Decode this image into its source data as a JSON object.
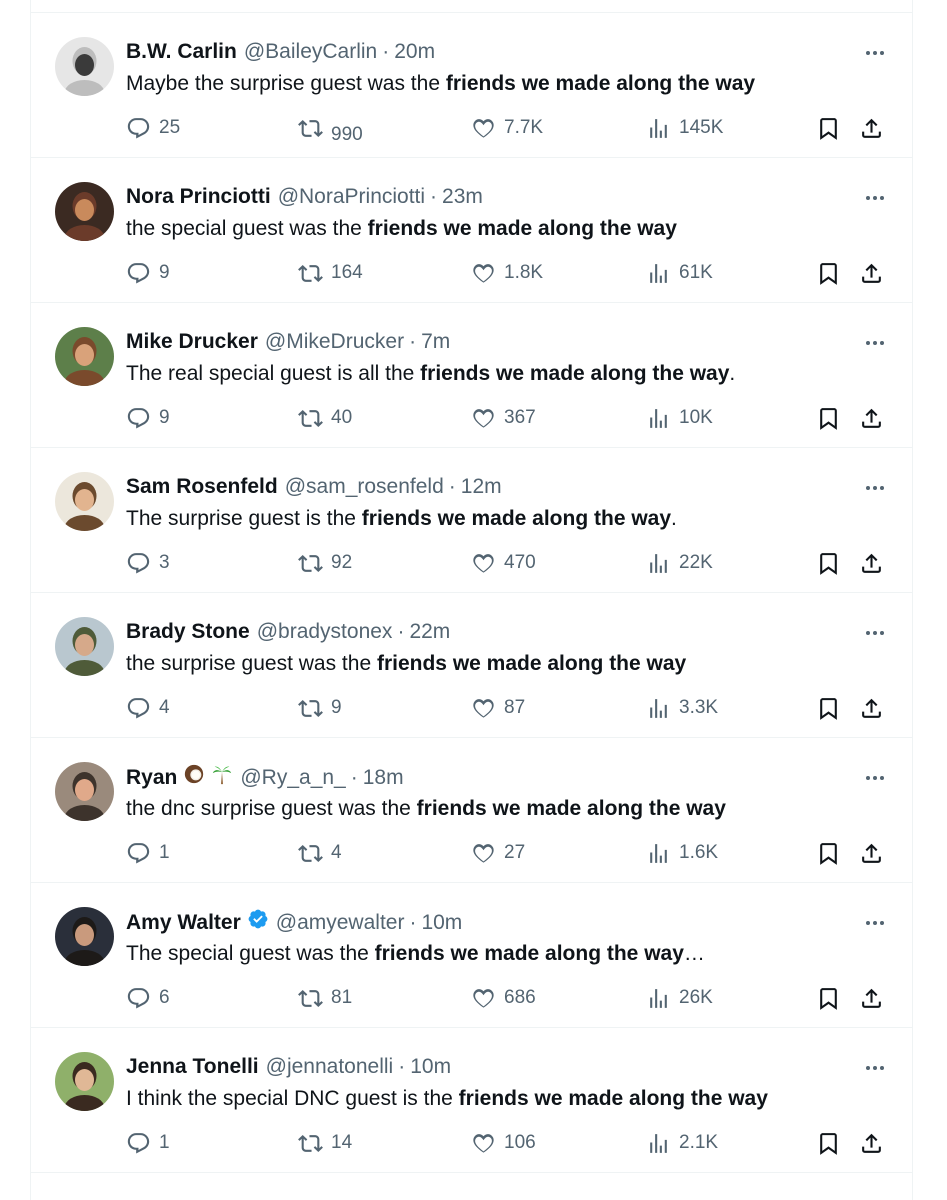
{
  "tweets": [
    {
      "name": "B.W. Carlin",
      "name_emoji": [],
      "verified": false,
      "handle": "@BaileyCarlin",
      "separator": "·",
      "time": "20m",
      "text_plain": "Maybe the surprise guest was the ",
      "text_bold": "friends we made along the way",
      "text_tail": "",
      "replies": "25",
      "retweets": "990",
      "likes": "7.7K",
      "views": "145K",
      "avatar_colors": [
        "#e6e6e6",
        "#3a3a3a",
        "#bdbdbd"
      ]
    },
    {
      "name": "Nora Princiotti",
      "name_emoji": [],
      "verified": false,
      "handle": "@NoraPrinciotti",
      "separator": "·",
      "time": "23m",
      "text_plain": "the special guest was the ",
      "text_bold": "friends we made along the way",
      "text_tail": "",
      "replies": "9",
      "retweets": "164",
      "likes": "1.8K",
      "views": "61K",
      "avatar_colors": [
        "#3b2a22",
        "#c98a5c",
        "#6b3b2a"
      ]
    },
    {
      "name": "Mike Drucker",
      "name_emoji": [],
      "verified": false,
      "handle": "@MikeDrucker",
      "separator": "·",
      "time": "7m",
      "text_plain": "The real special guest is all the ",
      "text_bold": "friends we made along the way",
      "text_tail": ".",
      "replies": "9",
      "retweets": "40",
      "likes": "367",
      "views": "10K",
      "avatar_colors": [
        "#5d7f4a",
        "#d9a27a",
        "#7a4a2c"
      ]
    },
    {
      "name": "Sam Rosenfeld",
      "name_emoji": [],
      "verified": false,
      "handle": "@sam_rosenfeld",
      "separator": "·",
      "time": "12m",
      "text_plain": "The surprise guest is the ",
      "text_bold": "friends we made along the way",
      "text_tail": ".",
      "replies": "3",
      "retweets": "92",
      "likes": "470",
      "views": "22K",
      "avatar_colors": [
        "#ece7dc",
        "#e2b48f",
        "#6b4a2e"
      ]
    },
    {
      "name": "Brady Stone",
      "name_emoji": [],
      "verified": false,
      "handle": "@bradystonex",
      "separator": "·",
      "time": "22m",
      "text_plain": "the surprise guest was the ",
      "text_bold": "friends we made along the way",
      "text_tail": "",
      "replies": "4",
      "retweets": "9",
      "likes": "87",
      "views": "3.3K",
      "avatar_colors": [
        "#b9c7cf",
        "#d6a98a",
        "#4f5b39"
      ]
    },
    {
      "name": "Ryan",
      "name_emoji": [
        "coconut-emoji",
        "palm-tree-emoji"
      ],
      "verified": false,
      "handle": "@Ry_a_n_",
      "separator": "·",
      "time": "18m",
      "text_plain": "the dnc surprise guest was the ",
      "text_bold": "friends we made along the way",
      "text_tail": "",
      "replies": "1",
      "retweets": "4",
      "likes": "27",
      "views": "1.6K",
      "avatar_colors": [
        "#9a8a7c",
        "#e0a98a",
        "#3d332c"
      ]
    },
    {
      "name": "Amy Walter",
      "name_emoji": [],
      "verified": true,
      "handle": "@amyewalter",
      "separator": "·",
      "time": "10m",
      "text_plain": "The special guest was the ",
      "text_bold": "friends we made along the way",
      "text_tail": "…",
      "replies": "6",
      "retweets": "81",
      "likes": "686",
      "views": "26K",
      "avatar_colors": [
        "#2a2f3a",
        "#c99a7d",
        "#1d1a18"
      ]
    },
    {
      "name": "Jenna Tonelli",
      "name_emoji": [],
      "verified": false,
      "handle": "@jennatonelli",
      "separator": "·",
      "time": "10m",
      "text_plain": "I think the special DNC guest is the ",
      "text_bold": "friends we made along the way",
      "text_tail": "",
      "replies": "1",
      "retweets": "14",
      "likes": "106",
      "views": "2.1K",
      "avatar_colors": [
        "#8fb06a",
        "#e0b896",
        "#3a2a20"
      ]
    }
  ],
  "icons": {
    "reply": "reply-icon",
    "retweet": "retweet-icon",
    "like": "heart-icon",
    "views": "views-chart-icon",
    "bookmark": "bookmark-icon",
    "share": "share-icon",
    "more": "more-dots-icon",
    "verified": "verified-badge-icon"
  },
  "colors": {
    "text_primary": "#0f1419",
    "text_secondary": "#536471",
    "divider": "#eff3f4",
    "verified_blue": "#1d9bf0"
  }
}
